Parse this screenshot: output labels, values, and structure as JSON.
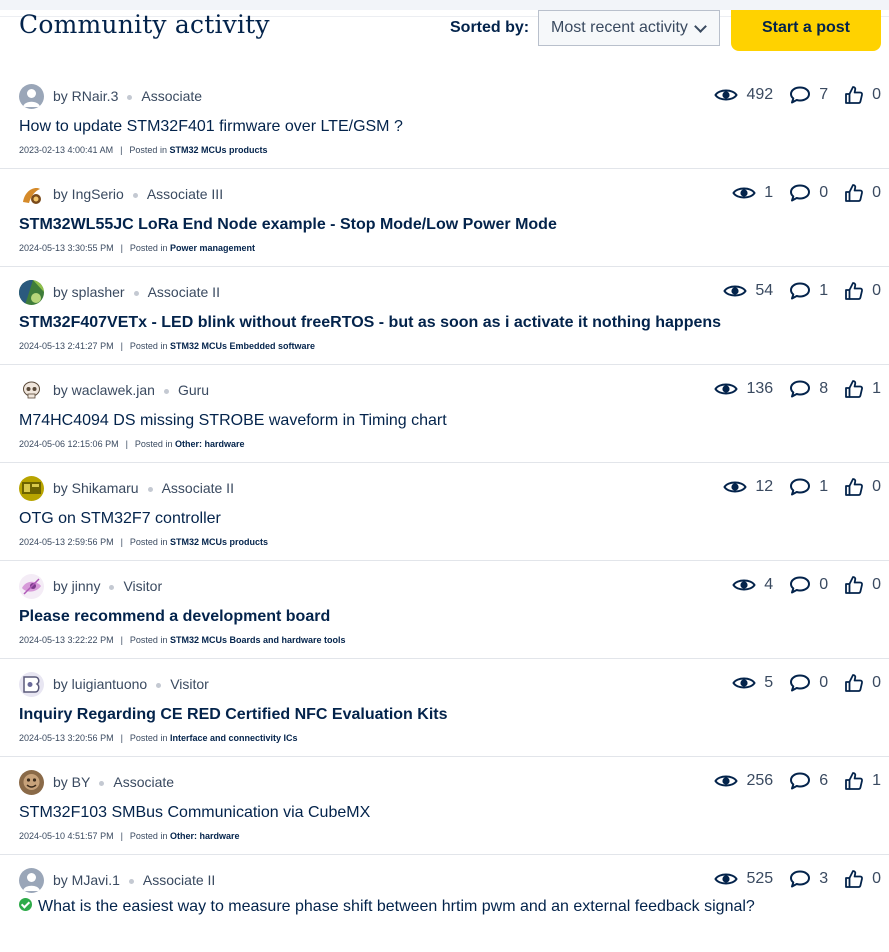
{
  "header": {
    "title": "Community activity",
    "sort_label": "Sorted by:",
    "sort_value": "Most recent activity",
    "start_post_label": "Start a post"
  },
  "colors": {
    "accent": "#ffd200",
    "text": "#03234b",
    "solved": "#2eab4a"
  },
  "icons": {
    "views": "eye-icon",
    "replies": "speech-bubble-icon",
    "kudos": "thumbs-up-icon",
    "solved": "check-circle-icon"
  },
  "posts": [
    {
      "by": "by RNair.3",
      "rank": "Associate",
      "title": "How to update STM32F401 firmware over LTE/GSM ?",
      "bold": false,
      "date": "2023-02-13 4:00:41 AM",
      "posted_in": "Posted in",
      "board": "STM32 MCUs products",
      "views": "492",
      "replies": "7",
      "kudos": "0",
      "avatar": "default"
    },
    {
      "by": "by IngSerio",
      "rank": "Associate III",
      "title": "STM32WL55JC LoRa End Node example - Stop Mode/Low Power Mode",
      "bold": true,
      "date": "2024-05-13 3:30:55 PM",
      "posted_in": "Posted in",
      "board": "Power management",
      "views": "1",
      "replies": "0",
      "kudos": "0",
      "avatar": "orange"
    },
    {
      "by": "by splasher",
      "rank": "Associate II",
      "title": "STM32F407VETx - LED blink without freeRTOS - but as soon as i activate it nothing happens",
      "bold": true,
      "date": "2024-05-13 2:41:27 PM",
      "posted_in": "Posted in",
      "board": "STM32 MCUs Embedded software",
      "views": "54",
      "replies": "1",
      "kudos": "0",
      "avatar": "green"
    },
    {
      "by": "by waclawek.jan",
      "rank": "Guru",
      "title": "M74HC4094 DS missing STROBE waveform in Timing chart",
      "bold": false,
      "date": "2024-05-06 12:15:06 PM",
      "posted_in": "Posted in",
      "board": "Other: hardware",
      "views": "136",
      "replies": "8",
      "kudos": "1",
      "avatar": "skull"
    },
    {
      "by": "by Shikamaru",
      "rank": "Associate II",
      "title": "OTG on STM32F7 controller",
      "bold": false,
      "date": "2024-05-13 2:59:56 PM",
      "posted_in": "Posted in",
      "board": "STM32 MCUs products",
      "views": "12",
      "replies": "1",
      "kudos": "0",
      "avatar": "olive"
    },
    {
      "by": "by jinny",
      "rank": "Visitor",
      "title": "Please recommend a development board",
      "bold": true,
      "date": "2024-05-13 3:22:22 PM",
      "posted_in": "Posted in",
      "board": "STM32 MCUs Boards and hardware tools",
      "views": "4",
      "replies": "0",
      "kudos": "0",
      "avatar": "purple"
    },
    {
      "by": "by luigiantuono",
      "rank": "Visitor",
      "title": "Inquiry Regarding CE RED Certified NFC Evaluation Kits",
      "bold": true,
      "date": "2024-05-13 3:20:56 PM",
      "posted_in": "Posted in",
      "board": "Interface and connectivity ICs",
      "views": "5",
      "replies": "0",
      "kudos": "0",
      "avatar": "lavender"
    },
    {
      "by": "by BY",
      "rank": "Associate",
      "title": "STM32F103 SMBus Communication via CubeMX",
      "bold": false,
      "date": "2024-05-10 4:51:57 PM",
      "posted_in": "Posted in",
      "board": "Other: hardware",
      "views": "256",
      "replies": "6",
      "kudos": "1",
      "avatar": "brown"
    },
    {
      "by": "by MJavi.1",
      "rank": "Associate II",
      "title": "What is the easiest way to measure phase shift between hrtim pwm and an external feedback signal?",
      "bold": false,
      "solved": true,
      "date": "",
      "posted_in": "",
      "board": "",
      "views": "525",
      "replies": "3",
      "kudos": "0",
      "avatar": "default"
    }
  ]
}
